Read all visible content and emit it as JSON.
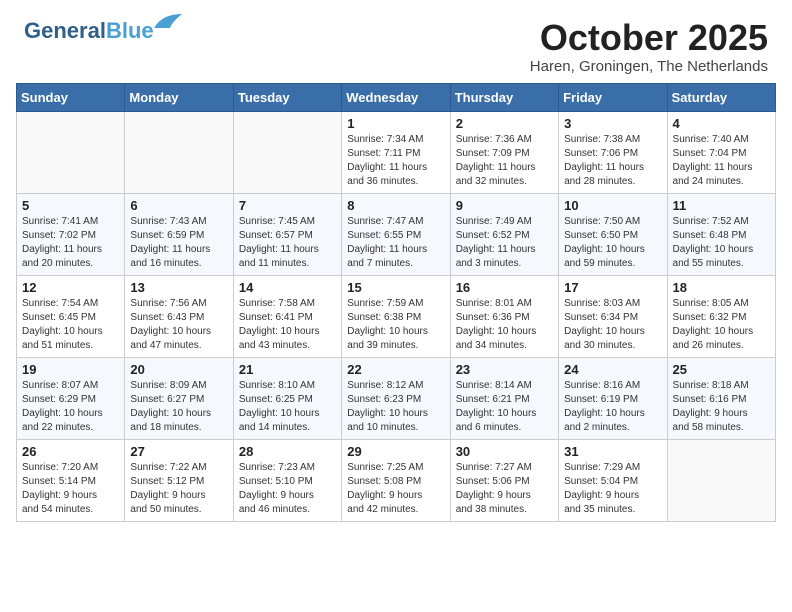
{
  "header": {
    "logo_general": "General",
    "logo_blue": "Blue",
    "title": "October 2025",
    "subtitle": "Haren, Groningen, The Netherlands"
  },
  "days_of_week": [
    "Sunday",
    "Monday",
    "Tuesday",
    "Wednesday",
    "Thursday",
    "Friday",
    "Saturday"
  ],
  "weeks": [
    [
      {
        "day": "",
        "content": ""
      },
      {
        "day": "",
        "content": ""
      },
      {
        "day": "",
        "content": ""
      },
      {
        "day": "1",
        "content": "Sunrise: 7:34 AM\nSunset: 7:11 PM\nDaylight: 11 hours\nand 36 minutes."
      },
      {
        "day": "2",
        "content": "Sunrise: 7:36 AM\nSunset: 7:09 PM\nDaylight: 11 hours\nand 32 minutes."
      },
      {
        "day": "3",
        "content": "Sunrise: 7:38 AM\nSunset: 7:06 PM\nDaylight: 11 hours\nand 28 minutes."
      },
      {
        "day": "4",
        "content": "Sunrise: 7:40 AM\nSunset: 7:04 PM\nDaylight: 11 hours\nand 24 minutes."
      }
    ],
    [
      {
        "day": "5",
        "content": "Sunrise: 7:41 AM\nSunset: 7:02 PM\nDaylight: 11 hours\nand 20 minutes."
      },
      {
        "day": "6",
        "content": "Sunrise: 7:43 AM\nSunset: 6:59 PM\nDaylight: 11 hours\nand 16 minutes."
      },
      {
        "day": "7",
        "content": "Sunrise: 7:45 AM\nSunset: 6:57 PM\nDaylight: 11 hours\nand 11 minutes."
      },
      {
        "day": "8",
        "content": "Sunrise: 7:47 AM\nSunset: 6:55 PM\nDaylight: 11 hours\nand 7 minutes."
      },
      {
        "day": "9",
        "content": "Sunrise: 7:49 AM\nSunset: 6:52 PM\nDaylight: 11 hours\nand 3 minutes."
      },
      {
        "day": "10",
        "content": "Sunrise: 7:50 AM\nSunset: 6:50 PM\nDaylight: 10 hours\nand 59 minutes."
      },
      {
        "day": "11",
        "content": "Sunrise: 7:52 AM\nSunset: 6:48 PM\nDaylight: 10 hours\nand 55 minutes."
      }
    ],
    [
      {
        "day": "12",
        "content": "Sunrise: 7:54 AM\nSunset: 6:45 PM\nDaylight: 10 hours\nand 51 minutes."
      },
      {
        "day": "13",
        "content": "Sunrise: 7:56 AM\nSunset: 6:43 PM\nDaylight: 10 hours\nand 47 minutes."
      },
      {
        "day": "14",
        "content": "Sunrise: 7:58 AM\nSunset: 6:41 PM\nDaylight: 10 hours\nand 43 minutes."
      },
      {
        "day": "15",
        "content": "Sunrise: 7:59 AM\nSunset: 6:38 PM\nDaylight: 10 hours\nand 39 minutes."
      },
      {
        "day": "16",
        "content": "Sunrise: 8:01 AM\nSunset: 6:36 PM\nDaylight: 10 hours\nand 34 minutes."
      },
      {
        "day": "17",
        "content": "Sunrise: 8:03 AM\nSunset: 6:34 PM\nDaylight: 10 hours\nand 30 minutes."
      },
      {
        "day": "18",
        "content": "Sunrise: 8:05 AM\nSunset: 6:32 PM\nDaylight: 10 hours\nand 26 minutes."
      }
    ],
    [
      {
        "day": "19",
        "content": "Sunrise: 8:07 AM\nSunset: 6:29 PM\nDaylight: 10 hours\nand 22 minutes."
      },
      {
        "day": "20",
        "content": "Sunrise: 8:09 AM\nSunset: 6:27 PM\nDaylight: 10 hours\nand 18 minutes."
      },
      {
        "day": "21",
        "content": "Sunrise: 8:10 AM\nSunset: 6:25 PM\nDaylight: 10 hours\nand 14 minutes."
      },
      {
        "day": "22",
        "content": "Sunrise: 8:12 AM\nSunset: 6:23 PM\nDaylight: 10 hours\nand 10 minutes."
      },
      {
        "day": "23",
        "content": "Sunrise: 8:14 AM\nSunset: 6:21 PM\nDaylight: 10 hours\nand 6 minutes."
      },
      {
        "day": "24",
        "content": "Sunrise: 8:16 AM\nSunset: 6:19 PM\nDaylight: 10 hours\nand 2 minutes."
      },
      {
        "day": "25",
        "content": "Sunrise: 8:18 AM\nSunset: 6:16 PM\nDaylight: 9 hours\nand 58 minutes."
      }
    ],
    [
      {
        "day": "26",
        "content": "Sunrise: 7:20 AM\nSunset: 5:14 PM\nDaylight: 9 hours\nand 54 minutes."
      },
      {
        "day": "27",
        "content": "Sunrise: 7:22 AM\nSunset: 5:12 PM\nDaylight: 9 hours\nand 50 minutes."
      },
      {
        "day": "28",
        "content": "Sunrise: 7:23 AM\nSunset: 5:10 PM\nDaylight: 9 hours\nand 46 minutes."
      },
      {
        "day": "29",
        "content": "Sunrise: 7:25 AM\nSunset: 5:08 PM\nDaylight: 9 hours\nand 42 minutes."
      },
      {
        "day": "30",
        "content": "Sunrise: 7:27 AM\nSunset: 5:06 PM\nDaylight: 9 hours\nand 38 minutes."
      },
      {
        "day": "31",
        "content": "Sunrise: 7:29 AM\nSunset: 5:04 PM\nDaylight: 9 hours\nand 35 minutes."
      },
      {
        "day": "",
        "content": ""
      }
    ]
  ]
}
